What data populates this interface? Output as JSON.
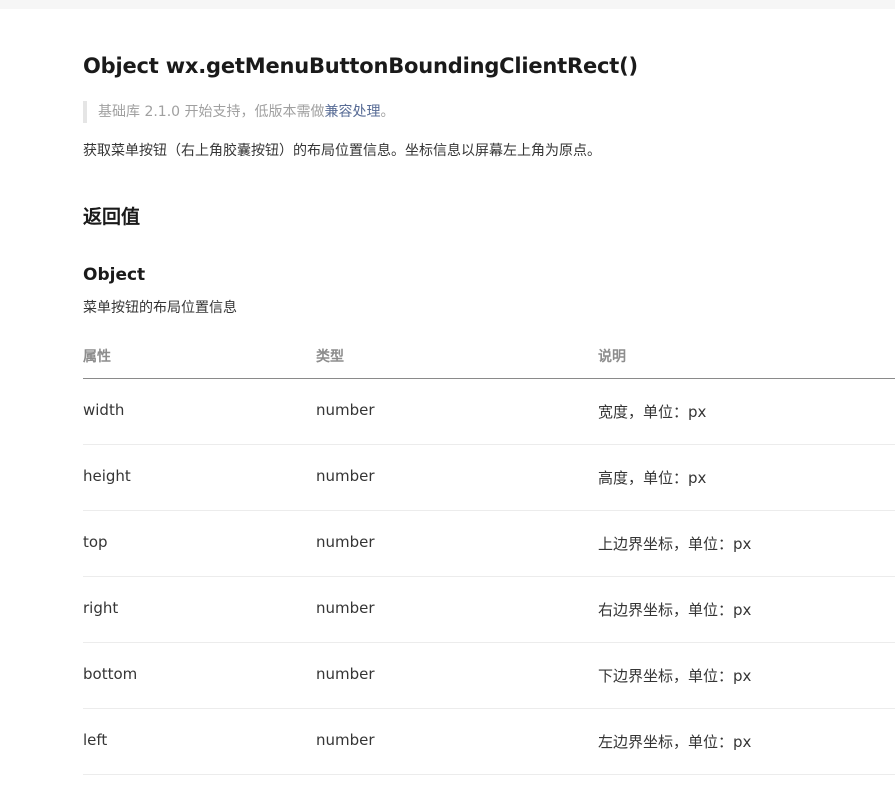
{
  "page": {
    "title": "Object wx.getMenuButtonBoundingClientRect()",
    "notice": {
      "prefix": "基础库 2.1.0 开始支持，低版本需做",
      "link": "兼容处理",
      "suffix": "。"
    },
    "description": "获取菜单按钮（右上角胶囊按钮）的布局位置信息。坐标信息以屏幕左上角为原点。",
    "section_heading": "返回值",
    "object_heading": "Object",
    "object_description": "菜单按钮的布局位置信息"
  },
  "table": {
    "headers": [
      "属性",
      "类型",
      "说明"
    ],
    "rows": [
      {
        "attr": "width",
        "type": "number",
        "desc": "宽度，单位：px"
      },
      {
        "attr": "height",
        "type": "number",
        "desc": "高度，单位：px"
      },
      {
        "attr": "top",
        "type": "number",
        "desc": "上边界坐标，单位：px"
      },
      {
        "attr": "right",
        "type": "number",
        "desc": "右边界坐标，单位：px"
      },
      {
        "attr": "bottom",
        "type": "number",
        "desc": "下边界坐标，单位：px"
      },
      {
        "attr": "left",
        "type": "number",
        "desc": "左边界坐标，单位：px"
      }
    ]
  },
  "colors": {
    "link": "#576b95",
    "notice_text": "#a0a0a0",
    "body_text": "#353535",
    "header_text": "#8d8d8d"
  }
}
